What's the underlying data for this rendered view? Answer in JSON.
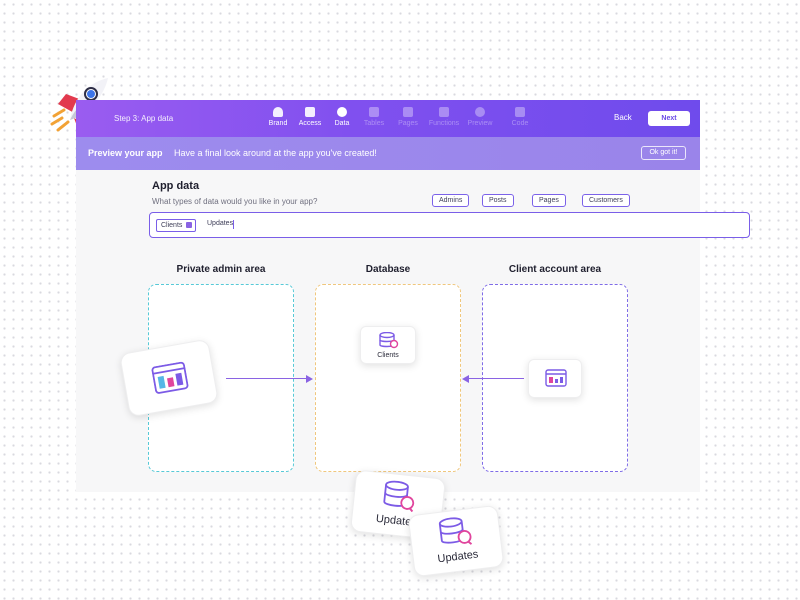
{
  "wizard": {
    "step_label": "Step 3: App data",
    "steps": [
      {
        "label": "Brand",
        "state": "done",
        "icon": "heart-icon"
      },
      {
        "label": "Access",
        "state": "done",
        "icon": "access-icon"
      },
      {
        "label": "Data",
        "state": "active",
        "icon": "pie-icon"
      },
      {
        "label": "Tables",
        "state": "pending",
        "icon": "table-icon"
      },
      {
        "label": "Pages",
        "state": "pending",
        "icon": "pages-icon"
      },
      {
        "label": "Functions",
        "state": "pending",
        "icon": "function-icon"
      },
      {
        "label": "Preview",
        "state": "pending",
        "icon": "preview-icon"
      },
      {
        "label": "Code",
        "state": "pending",
        "icon": "code-icon"
      }
    ],
    "back_label": "Back",
    "next_label": "Next"
  },
  "preview": {
    "title": "Preview your app",
    "subtitle": "Have a final look around at the app you've created!",
    "ok_label": "Ok got it!"
  },
  "app_data": {
    "title": "App data",
    "subtitle": "What types of data would you like in your app?",
    "suggestions": [
      "Admins",
      "Posts",
      "Pages",
      "Customers"
    ],
    "tags": [
      "Clients"
    ],
    "typed_value": "Updates"
  },
  "columns": {
    "private": {
      "label": "Private admin area"
    },
    "database": {
      "label": "Database",
      "item": "Clients"
    },
    "client": {
      "label": "Client account area"
    }
  },
  "floating_cards": [
    {
      "label": "Updates",
      "icon": "database-search-icon"
    },
    {
      "label": "Updates",
      "icon": "database-search-icon"
    }
  ],
  "colors": {
    "accent": "#7a5ee8",
    "teal_zone": "#57c9d7",
    "amber_zone": "#f0c77d",
    "violet_zone": "#7f6ce7",
    "wizard_gradient_start": "#9a5cf0",
    "wizard_gradient_end": "#6f4bec",
    "preview_bar": "#9d8cee"
  }
}
